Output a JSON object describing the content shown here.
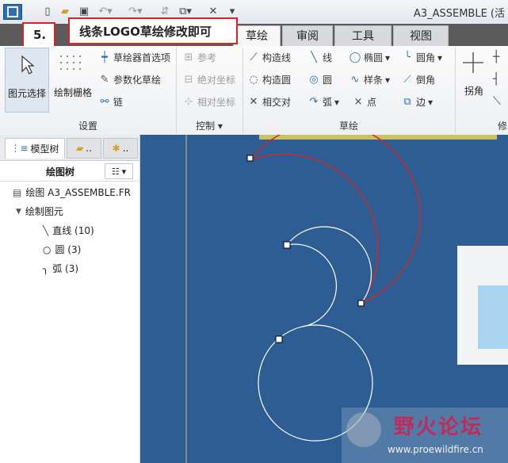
{
  "window": {
    "title": "A3_ASSEMBLE (活"
  },
  "callouts": {
    "step": "5.",
    "note": "线条LOGO草绘修改即可"
  },
  "tabs": [
    {
      "label": "草绘",
      "active": true
    },
    {
      "label": "审阅"
    },
    {
      "label": "工具"
    },
    {
      "label": "视图"
    }
  ],
  "ribbon": {
    "select_label": "图元选择",
    "grid_label": "绘制栅格",
    "sketcher_prefs": "草绘器首选项",
    "param_sketch": "参数化草绘",
    "chain": "链",
    "reference": "参考",
    "abs_coord": "绝对坐标",
    "rel_coord": "相对坐标",
    "construct_line": "构造线",
    "construct_circle": "构造圆",
    "intersect": "相交对",
    "line": "线",
    "circle": "圆",
    "arc": "弧",
    "ellipse": "椭圆",
    "spline": "样条",
    "point": "点",
    "fillet": "圆角",
    "chamfer": "倒角",
    "edge": "边",
    "corner": "拐角",
    "groups": {
      "settings": "设置",
      "control": "控制",
      "sketch": "草绘",
      "modify": "修"
    }
  },
  "panel": {
    "tabs": [
      {
        "label": "模型树"
      },
      {
        "label": ".."
      },
      {
        "label": ".."
      }
    ],
    "tree_title": "绘图树",
    "root": "绘图 A3_ASSEMBLE.FR",
    "group": "绘制图元",
    "items": [
      {
        "label": "直线 (10)",
        "icon": "line-icon"
      },
      {
        "label": "圆 (3)",
        "icon": "circle-icon"
      },
      {
        "label": "弧 (3)",
        "icon": "arc-icon"
      }
    ]
  },
  "watermark": {
    "title": "野火论坛",
    "url": "www.proewildfire.cn"
  },
  "colors": {
    "canvas": "#2d5d93",
    "selected": "#cc2a2a",
    "callout_border": "#d22222",
    "accent": "#2a6fb8"
  }
}
